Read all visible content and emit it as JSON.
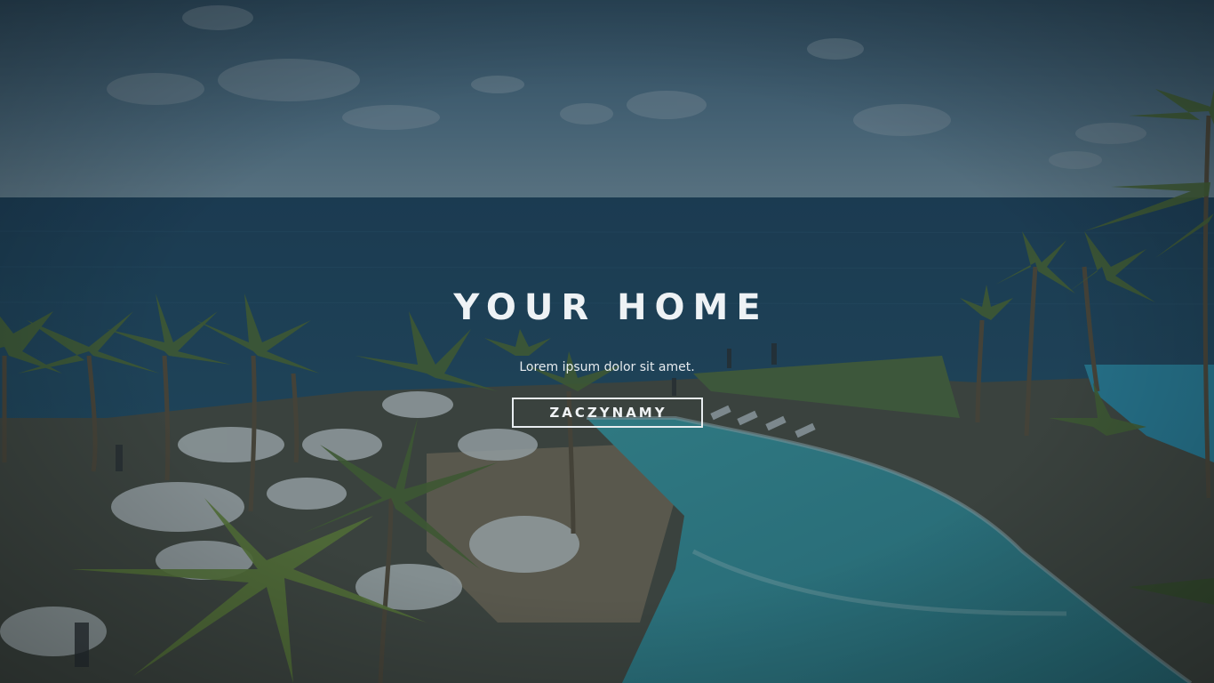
{
  "hero": {
    "title": "YOUR HOME",
    "subtitle": "Lorem ipsum dolor sit amet.",
    "button_label": "ZACZYNAMY",
    "background": "resort-pool-ocean-photo"
  },
  "colors": {
    "overlay": "#1e3440",
    "sky": "#5f7f95",
    "ocean": "#1d4763",
    "pool": "#2f8f9a",
    "text": "#eef2f5"
  }
}
